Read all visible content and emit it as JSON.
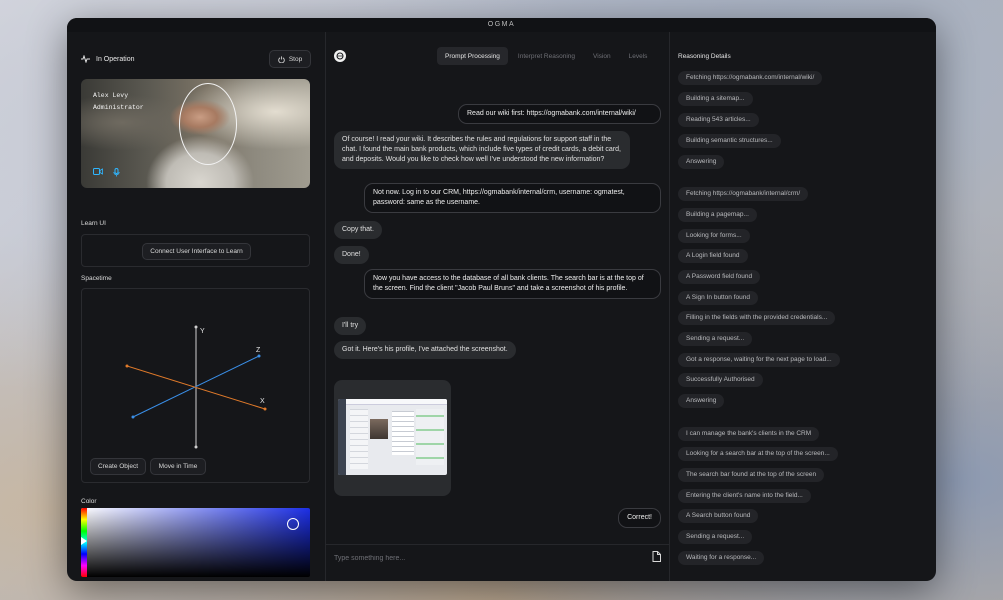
{
  "window": {
    "title": "OGMA"
  },
  "left": {
    "status": "In Operation",
    "stop_label": "Stop",
    "user": {
      "name": "Alex Levy",
      "role": "Administrator"
    },
    "learn_ui": {
      "label": "Learn UI",
      "button": "Connect User Interface to Learn"
    },
    "spacetime": {
      "label": "Spacetime",
      "axes": {
        "x": "X",
        "y": "Y",
        "z": "Z"
      },
      "create_object": "Create Object",
      "move_in_time": "Move in Time"
    },
    "color": {
      "label": "Color",
      "value": "#1c2fe6"
    }
  },
  "center": {
    "tabs": [
      "Prompt Processing",
      "Interpret Reasoning",
      "Vision",
      "Levels"
    ],
    "active_tab": "Prompt Processing",
    "messages": [
      {
        "role": "user",
        "text": "Read our wiki first: https://ogmabank.com/internal/wiki/"
      },
      {
        "role": "bot",
        "text": "Of course! I read your wiki. It describes the rules and regulations for support staff in the chat. I found the main bank products, which include five types of credit cards, a debit card, and deposits. Would you like to check how well I've understood the new information?"
      },
      {
        "role": "user",
        "text": "Not now. Log in to our CRM, https://ogmabank/internal/crm, username: ogmatest, password: same as the username."
      },
      {
        "role": "bot",
        "text": "Copy that."
      },
      {
        "role": "bot",
        "text": "Done!"
      },
      {
        "role": "user",
        "text": "Now you have access to the database of all bank clients. The search bar is at the top of the screen. Find the client \"Jacob Paul Bruns\" and take a screenshot of his profile."
      },
      {
        "role": "bot",
        "text": "I'll try"
      },
      {
        "role": "bot",
        "text": "Got it. Here's his profile, I've attached the screenshot."
      },
      {
        "role": "user",
        "text": "Correct!"
      }
    ],
    "input_placeholder": "Type something here..."
  },
  "right": {
    "title": "Reasoning Details",
    "steps": [
      "Fetching https://ogmabank.com/internal/wiki/",
      "Building a sitemap...",
      "Reading 543 articles...",
      "Building semantic structures...",
      "Answering",
      "Fetching https://ogmabank/internal/crm/",
      "Building a pagemap...",
      "Looking for forms...",
      "A Login field found",
      "A Password field found",
      "A Sign In button found",
      "Filling in the fields with the provided credentials...",
      "Sending a request...",
      "Got a response, waiting for the next page to load...",
      "Successfully Authorised",
      "Answering",
      "I can manage the bank's clients in the CRM",
      "Looking for a search bar at the top of the screen...",
      "The search bar found at the top of the screen",
      "Entering the client's name into the field...",
      "A Search button found",
      "Sending a request...",
      "Waiting for a response..."
    ]
  }
}
